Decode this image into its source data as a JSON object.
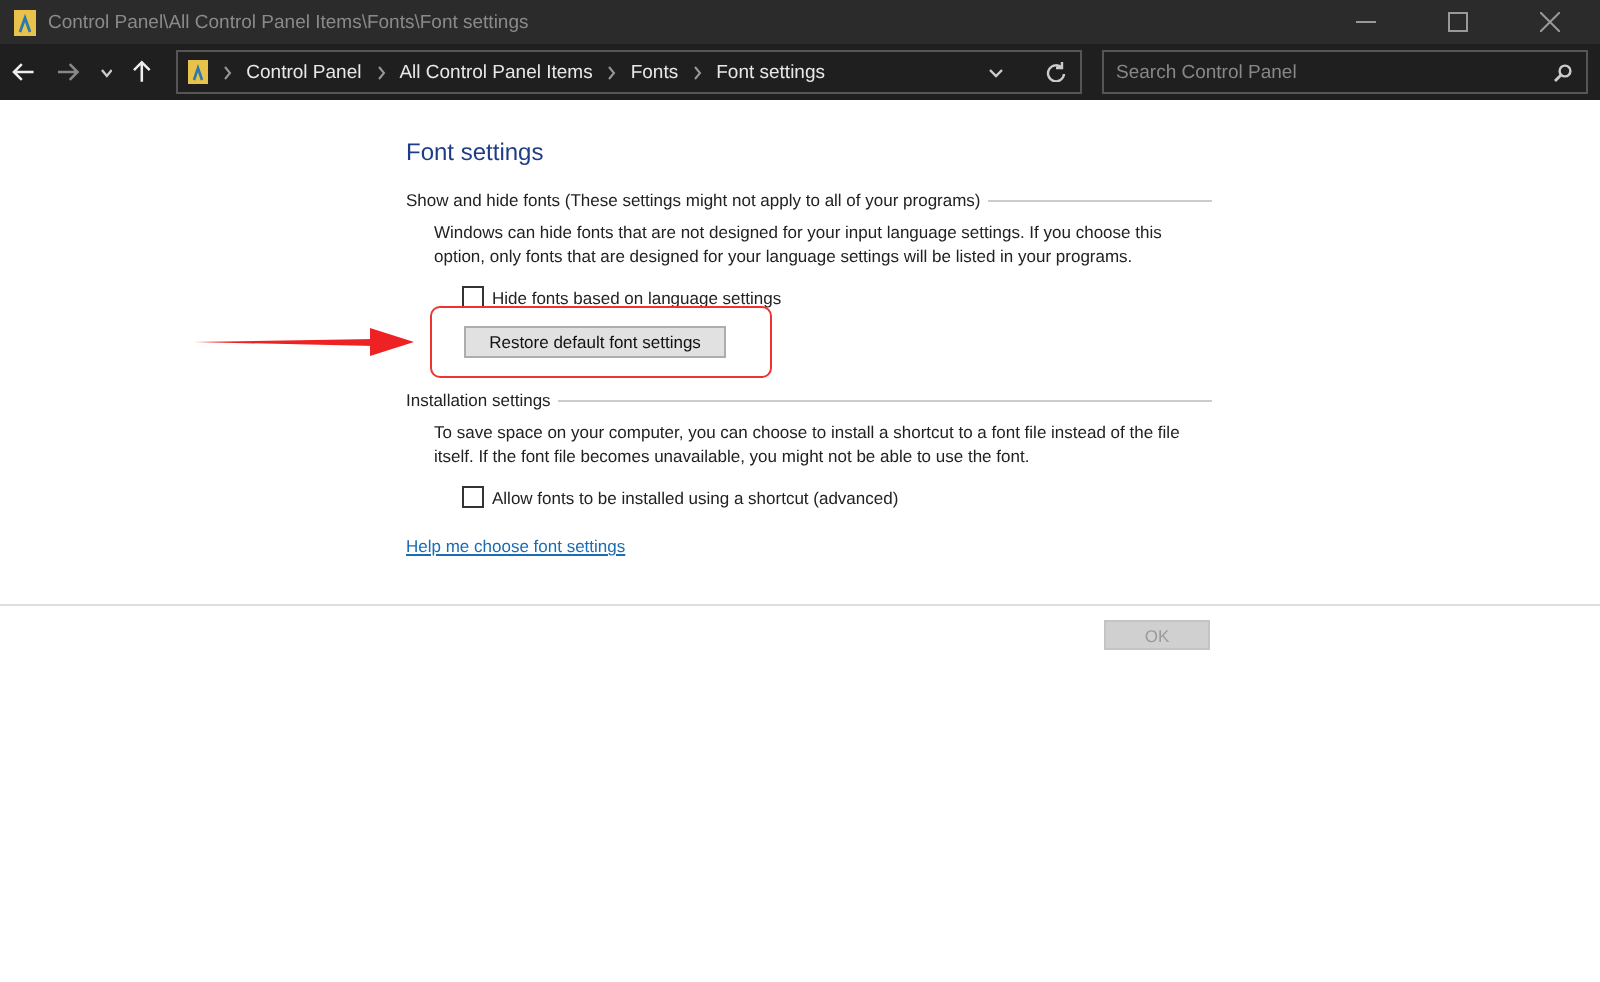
{
  "window": {
    "title": "Control Panel\\All Control Panel Items\\Fonts\\Font settings"
  },
  "breadcrumb": [
    "Control Panel",
    "All Control Panel Items",
    "Fonts",
    "Font settings"
  ],
  "search": {
    "placeholder": "Search Control Panel"
  },
  "page_title": "Font settings",
  "sections": [
    {
      "heading": "Show and hide fonts (These settings might not apply to all of your programs)",
      "description": "Windows can hide fonts that are not designed for your input language settings. If you choose this option, only fonts that are designed for your language settings will be listed in your programs.",
      "checkbox": {
        "label": "Hide fonts based on language settings",
        "checked": false
      },
      "button": "Restore default font settings"
    },
    {
      "heading": "Installation settings",
      "description": "To save space on your computer, you can choose to install a shortcut to a font file instead of the file itself. If the font file becomes unavailable, you might not be able to use the font.",
      "checkbox": {
        "label": "Allow fonts to be installed using a shortcut (advanced)",
        "checked": false
      }
    }
  ],
  "help_link": "Help me choose font settings",
  "ok_button": {
    "label": "OK",
    "disabled": true
  }
}
